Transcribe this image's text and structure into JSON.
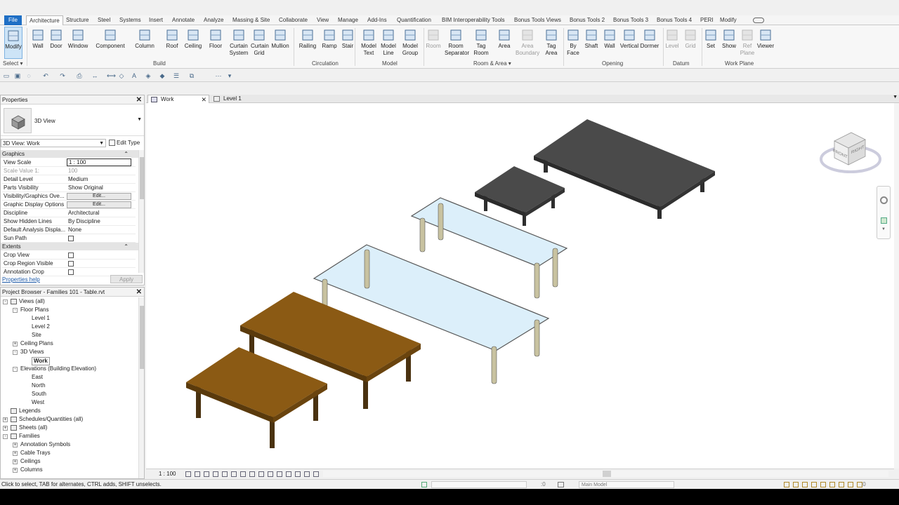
{
  "ribbon_tabs": {
    "file": "File",
    "items": [
      "Architecture",
      "Structure",
      "Steel",
      "Systems",
      "Insert",
      "Annotate",
      "Analyze",
      "Massing & Site",
      "Collaborate",
      "View",
      "Manage",
      "Add-Ins",
      "Quantification",
      "BIM Interoperability Tools",
      "Bonus Tools Views",
      "Bonus Tools 2",
      "Bonus Tools 3",
      "Bonus Tools 4",
      "PERI",
      "Modify"
    ]
  },
  "ribbon": {
    "buttons": [
      {
        "label": "Modify"
      },
      {
        "label": "Wall"
      },
      {
        "label": "Door"
      },
      {
        "label": "Window"
      },
      {
        "label": "Component"
      },
      {
        "label": "Column"
      },
      {
        "label": "Roof"
      },
      {
        "label": "Ceiling"
      },
      {
        "label": "Floor"
      },
      {
        "label": "Curtain System"
      },
      {
        "label": "Curtain Grid"
      },
      {
        "label": "Mullion"
      },
      {
        "label": "Railing"
      },
      {
        "label": "Ramp"
      },
      {
        "label": "Stair"
      },
      {
        "label": "Model Text"
      },
      {
        "label": "Model Line"
      },
      {
        "label": "Model Group"
      },
      {
        "label": "Room"
      },
      {
        "label": "Room Separator"
      },
      {
        "label": "Tag Room"
      },
      {
        "label": "Area"
      },
      {
        "label": "Area Boundary"
      },
      {
        "label": "Tag Area"
      },
      {
        "label": "By Face"
      },
      {
        "label": "Shaft"
      },
      {
        "label": "Wall"
      },
      {
        "label": "Vertical"
      },
      {
        "label": "Dormer"
      },
      {
        "label": "Level"
      },
      {
        "label": "Grid"
      },
      {
        "label": "Set"
      },
      {
        "label": "Show"
      },
      {
        "label": "Ref Plane"
      },
      {
        "label": "Viewer"
      }
    ],
    "panels": [
      "Select",
      "Build",
      "Circulation",
      "Model",
      "Room & Area",
      "Opening",
      "Datum",
      "Work Plane"
    ]
  },
  "properties": {
    "title": "Properties",
    "type_name": "3D View",
    "view_selector": "3D View: Work",
    "edit_type": "Edit Type",
    "section_graphics": "Graphics",
    "rows": [
      {
        "k": "View Scale",
        "v": "1 : 100"
      },
      {
        "k": "Scale Value    1:",
        "v": "100"
      },
      {
        "k": "Detail Level",
        "v": "Medium"
      },
      {
        "k": "Parts Visibility",
        "v": "Show Original"
      },
      {
        "k": "Visibility/Graphics Ove...",
        "v": "Edit..."
      },
      {
        "k": "Graphic Display Options",
        "v": "Edit..."
      },
      {
        "k": "Discipline",
        "v": "Architectural"
      },
      {
        "k": "Show Hidden Lines",
        "v": "By Discipline"
      },
      {
        "k": "Default Analysis Displa...",
        "v": "None"
      },
      {
        "k": "Sun Path",
        "v": ""
      }
    ],
    "section_extents": "Extents",
    "extent_rows": [
      "Crop View",
      "Crop Region Visible",
      "Annotation Crop"
    ],
    "help": "Properties help",
    "apply": "Apply"
  },
  "browser": {
    "title": "Project Browser - Families 101 - Table.rvt",
    "nodes": [
      {
        "label": "Views (all)",
        "lvl": 0,
        "tog": "-",
        "icon": true
      },
      {
        "label": "Floor Plans",
        "lvl": 1,
        "tog": "-"
      },
      {
        "label": "Level 1",
        "lvl": 2
      },
      {
        "label": "Level 2",
        "lvl": 2
      },
      {
        "label": "Site",
        "lvl": 2
      },
      {
        "label": "Ceiling Plans",
        "lvl": 1,
        "tog": "+"
      },
      {
        "label": "3D Views",
        "lvl": 1,
        "tog": "-"
      },
      {
        "label": "Work",
        "lvl": 2,
        "bold": true
      },
      {
        "label": "Elevations (Building Elevation)",
        "lvl": 1,
        "tog": "-"
      },
      {
        "label": "East",
        "lvl": 2
      },
      {
        "label": "North",
        "lvl": 2
      },
      {
        "label": "South",
        "lvl": 2
      },
      {
        "label": "West",
        "lvl": 2
      },
      {
        "label": "Legends",
        "lvl": 0,
        "tog": "",
        "icon": true
      },
      {
        "label": "Schedules/Quantities (all)",
        "lvl": 0,
        "tog": "+",
        "icon": true
      },
      {
        "label": "Sheets (all)",
        "lvl": 0,
        "tog": "+",
        "icon": true
      },
      {
        "label": "Families",
        "lvl": 0,
        "tog": "-",
        "icon": true
      },
      {
        "label": "Annotation Symbols",
        "lvl": 1,
        "tog": "+"
      },
      {
        "label": "Cable Trays",
        "lvl": 1,
        "tog": "+"
      },
      {
        "label": "Ceilings",
        "lvl": 1,
        "tog": "+"
      },
      {
        "label": "Columns",
        "lvl": 1,
        "tog": "+"
      }
    ]
  },
  "view_tabs": [
    {
      "label": "Work"
    },
    {
      "label": "Level 1"
    }
  ],
  "view_bar": {
    "scale": "1 : 100"
  },
  "viewcube": {
    "front": "FRONT",
    "right": "RIGHT"
  },
  "status": {
    "hint": "Click to select, TAB for alternates, CTRL adds, SHIFT unselects.",
    "sel_count": ":0",
    "model": "Main Model",
    "filter_count": ":0"
  },
  "colors": {
    "file_tab": "#1f6fc5",
    "wood": "#8b5a14",
    "dark": "#4a4a4a",
    "glass": "#dceffa"
  }
}
